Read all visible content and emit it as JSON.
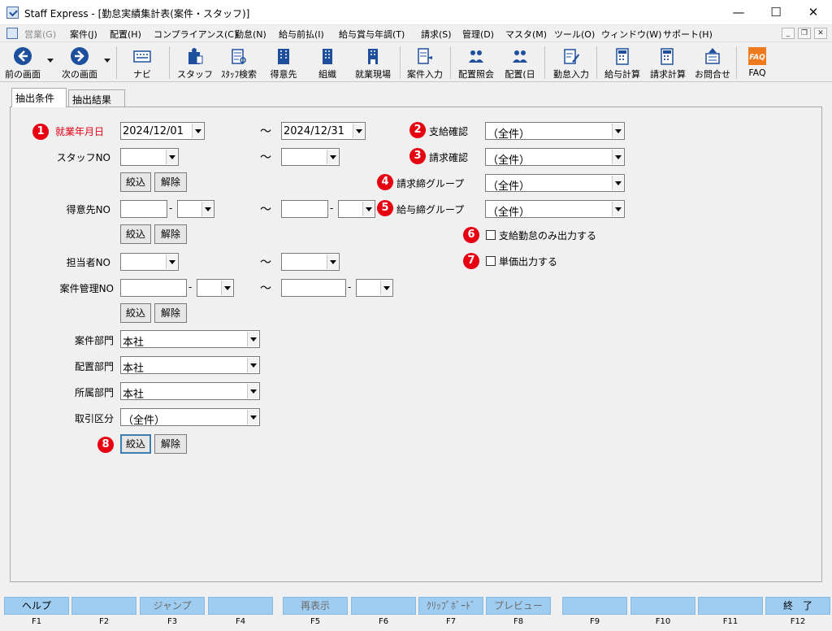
{
  "window": {
    "title": "Staff Express - [勤怠実績集計表(案件・スタッフ)]",
    "controls": {
      "minimize": "—",
      "maximize": "☐",
      "close": "✕"
    }
  },
  "menubar": {
    "items": [
      {
        "label": "営業(G)",
        "disabled": true
      },
      {
        "label": "案件(J)"
      },
      {
        "label": "配置(H)"
      },
      {
        "label": "コンプライアンス(C)"
      },
      {
        "label": "勤怠(N)"
      },
      {
        "label": "給与前払(I)"
      },
      {
        "label": "給与賞与年調(T)"
      },
      {
        "label": "請求(S)"
      },
      {
        "label": "管理(D)"
      },
      {
        "label": "マスタ(M)"
      },
      {
        "label": "ツール(O)"
      },
      {
        "label": "ウィンドウ(W)"
      },
      {
        "label": "サポート(H)"
      }
    ],
    "mdi_controls": {
      "minimize": "_",
      "restore": "❐",
      "close": "✕"
    }
  },
  "toolbar": {
    "back": "前の画面",
    "forward": "次の画面",
    "navi": "ナビ",
    "staff": "スタッフ",
    "staff_search": "ｽﾀｯﾌ検索",
    "customer": "得意先",
    "organization": "組織",
    "worksite": "就業現場",
    "case_input": "案件入力",
    "assign_inquiry": "配置照会",
    "assign_day": "配置(日",
    "attendance_input": "勤怠入力",
    "payroll_calc": "給与計算",
    "billing_calc": "請求計算",
    "inquiry": "お問合せ",
    "faq": "FAQ",
    "faq_icon_text": "FAQ",
    "colors": {
      "accent": "#1d4f9c",
      "faq_orange": "#f07a1e"
    }
  },
  "tabs": [
    {
      "label": "抽出条件",
      "active": true
    },
    {
      "label": "抽出結果",
      "active": false
    }
  ],
  "form": {
    "badges": [
      "1",
      "2",
      "3",
      "4",
      "5",
      "6",
      "7",
      "8"
    ],
    "work_month": {
      "label": "就業年月日",
      "from": "2024/12/01",
      "to": "2024/12/31"
    },
    "staff_no": {
      "label": "スタッフNO",
      "from": "",
      "to": ""
    },
    "customer_no": {
      "label": "得意先NO",
      "from_1": "",
      "from_2": "",
      "to_1": "",
      "to_2": ""
    },
    "person_in_charge_no": {
      "label": "担当者NO",
      "from": "",
      "to": ""
    },
    "case_mgmt_no": {
      "label": "案件管理NO",
      "from_1": "",
      "from_2": "",
      "to_1": "",
      "to_2": ""
    },
    "case_dept": {
      "label": "案件部門",
      "value": "本社"
    },
    "assign_dept": {
      "label": "配置部門",
      "value": "本社"
    },
    "belong_dept": {
      "label": "所属部門",
      "value": "本社"
    },
    "transaction_type": {
      "label": "取引区分",
      "value": "（全件）"
    },
    "pay_confirm": {
      "label": "支給確認",
      "value": "（全件）"
    },
    "billing_confirm": {
      "label": "請求確認",
      "value": "（全件）"
    },
    "billing_close_group": {
      "label": "請求締グループ",
      "value": "（全件）"
    },
    "pay_close_group": {
      "label": "給与締グループ",
      "value": "（全件）"
    },
    "pay_attendance_only": {
      "label": "支給勤怠のみ出力する",
      "checked": false
    },
    "unit_price_output": {
      "label": "単価出力する",
      "checked": false
    },
    "filter_label": "絞込",
    "clear_label": "解除",
    "tilde": "～",
    "dash": "-"
  },
  "fkeys": [
    {
      "label": "ヘルプ",
      "key": "F1",
      "disabled": false
    },
    {
      "label": "",
      "key": "F2",
      "disabled": false
    },
    {
      "label": "ジャンプ",
      "key": "F3",
      "disabled": true
    },
    {
      "label": "",
      "key": "F4",
      "disabled": false
    },
    {
      "label": "再表示",
      "key": "F5",
      "disabled": true
    },
    {
      "label": "",
      "key": "F6",
      "disabled": false
    },
    {
      "label": "ｸﾘｯﾌﾟﾎﾞｰﾄﾞ",
      "key": "F7",
      "disabled": true
    },
    {
      "label": "プレビュー",
      "key": "F8",
      "disabled": true
    },
    {
      "label": "",
      "key": "F9",
      "disabled": false
    },
    {
      "label": "",
      "key": "F10",
      "disabled": false
    },
    {
      "label": "",
      "key": "F11",
      "disabled": false
    },
    {
      "label": "終　了",
      "key": "F12",
      "disabled": false
    }
  ]
}
